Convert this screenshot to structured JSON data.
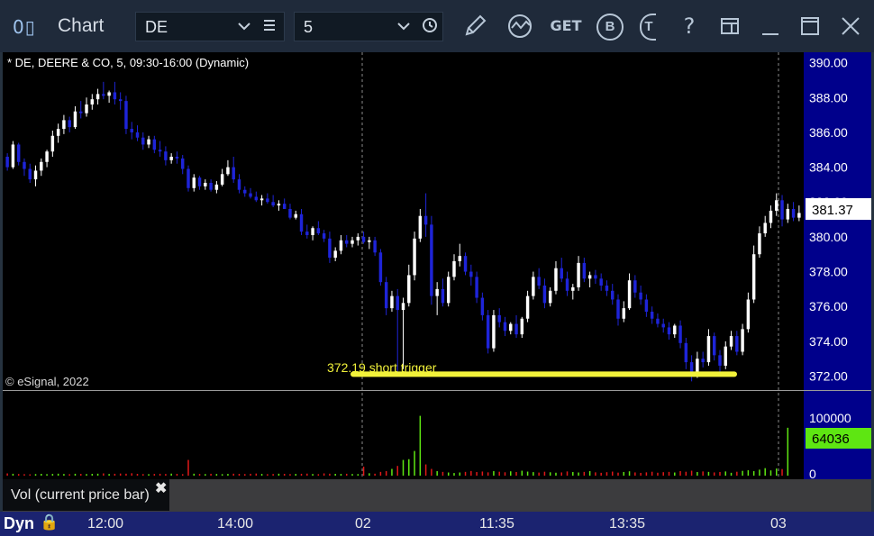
{
  "window": {
    "logo": "0▯",
    "title": "Chart",
    "symbol_value": "DE",
    "interval_value": "5",
    "icons": [
      "drawing-pencil-icon",
      "study-icon",
      "get-icon",
      "b-icon",
      "t-icon",
      "help-icon",
      "layout-icon",
      "minimize-icon",
      "maximize-icon",
      "close-icon"
    ],
    "get_label": "GET",
    "b_label": "B",
    "t_label": "T",
    "help_label": "?"
  },
  "chart": {
    "header": "* DE, DEERE & CO, 5, 09:30-16:00 (Dynamic)",
    "watermark": "© eSignal, 2022",
    "last_price": "381.37",
    "annotation_text": "372.19 short trigger",
    "annotation_color": "#f2f23a",
    "up_color": "#ffffff",
    "down_color": "#1e24d8",
    "price_axis": [
      "390.00",
      "388.00",
      "386.00",
      "384.00",
      "382.00",
      "380.00",
      "378.00",
      "376.00",
      "374.00",
      "372.00"
    ],
    "volume_axis": [
      "100000",
      "0"
    ],
    "volume_last": "64036",
    "volume_label": "Vol (current price bar)",
    "close_label": "✖",
    "time_labels": [
      "12:00",
      "14:00",
      "02",
      "11:35",
      "13:35",
      "03"
    ],
    "dyn_label": "Dyn",
    "lock_label": "🔒"
  },
  "chart_data": {
    "type": "candlestick",
    "symbol": "DE",
    "ylim": [
      371.2,
      390.6
    ],
    "price_ticks": [
      390,
      388,
      386,
      384,
      382,
      380,
      378,
      376,
      374,
      372
    ],
    "support_level": 372.19,
    "last_price": 381.37,
    "volume_last": 64036,
    "volume_max": 100000,
    "candles": [
      [
        384.6,
        384.8,
        383.8,
        384.0
      ],
      [
        384.0,
        385.5,
        383.9,
        385.3
      ],
      [
        385.3,
        385.4,
        384.1,
        384.3
      ],
      [
        384.3,
        384.5,
        383.5,
        383.9
      ],
      [
        383.9,
        384.2,
        383.1,
        383.3
      ],
      [
        383.3,
        384.1,
        382.9,
        383.8
      ],
      [
        383.8,
        384.5,
        383.5,
        384.3
      ],
      [
        384.3,
        385.0,
        384.0,
        384.9
      ],
      [
        384.9,
        386.1,
        384.6,
        385.8
      ],
      [
        385.8,
        386.5,
        385.4,
        386.2
      ],
      [
        386.2,
        387.0,
        385.9,
        386.7
      ],
      [
        386.7,
        386.9,
        386.0,
        386.3
      ],
      [
        386.3,
        387.5,
        386.2,
        387.2
      ],
      [
        387.2,
        387.8,
        386.8,
        387.1
      ],
      [
        387.1,
        388.0,
        386.9,
        387.6
      ],
      [
        387.6,
        388.2,
        387.3,
        387.9
      ],
      [
        387.9,
        388.5,
        387.6,
        388.2
      ],
      [
        388.2,
        388.9,
        387.9,
        388.1
      ],
      [
        388.1,
        388.4,
        387.7,
        388.3
      ],
      [
        388.3,
        388.9,
        387.6,
        387.9
      ],
      [
        387.9,
        388.3,
        387.3,
        387.8
      ],
      [
        387.8,
        388.1,
        385.9,
        386.2
      ],
      [
        386.2,
        386.6,
        385.6,
        386.0
      ],
      [
        386.0,
        386.4,
        385.5,
        385.7
      ],
      [
        385.7,
        386.0,
        385.0,
        385.3
      ],
      [
        385.3,
        385.8,
        385.1,
        385.6
      ],
      [
        385.6,
        385.8,
        384.8,
        385.0
      ],
      [
        385.0,
        385.5,
        384.6,
        384.9
      ],
      [
        384.9,
        385.2,
        384.1,
        384.4
      ],
      [
        384.4,
        384.8,
        384.2,
        384.6
      ],
      [
        384.6,
        384.9,
        384.2,
        384.5
      ],
      [
        384.5,
        384.7,
        383.6,
        383.9
      ],
      [
        383.9,
        384.1,
        382.6,
        382.8
      ],
      [
        382.8,
        383.6,
        382.6,
        383.4
      ],
      [
        383.4,
        383.5,
        382.7,
        382.9
      ],
      [
        382.9,
        383.3,
        382.7,
        383.1
      ],
      [
        383.1,
        383.3,
        382.6,
        382.7
      ],
      [
        382.7,
        383.2,
        382.5,
        383.0
      ],
      [
        383.0,
        383.9,
        382.9,
        383.6
      ],
      [
        383.6,
        384.4,
        383.5,
        384.0
      ],
      [
        384.0,
        384.6,
        383.1,
        383.3
      ],
      [
        383.3,
        383.6,
        382.5,
        382.7
      ],
      [
        382.7,
        382.9,
        382.3,
        382.5
      ],
      [
        382.5,
        382.8,
        382.2,
        382.3
      ],
      [
        382.3,
        382.6,
        382.0,
        382.1
      ],
      [
        382.1,
        382.4,
        381.8,
        382.2
      ],
      [
        382.2,
        382.5,
        381.9,
        382.0
      ],
      [
        382.0,
        382.4,
        381.7,
        381.8
      ],
      [
        381.8,
        382.1,
        381.5,
        381.9
      ],
      [
        381.9,
        382.2,
        381.6,
        381.6
      ],
      [
        381.6,
        381.9,
        381.0,
        381.1
      ],
      [
        381.1,
        381.5,
        381.0,
        381.3
      ],
      [
        381.3,
        381.6,
        380.1,
        380.3
      ],
      [
        380.3,
        380.7,
        379.9,
        380.1
      ],
      [
        380.1,
        380.6,
        379.8,
        380.5
      ],
      [
        380.5,
        380.9,
        380.1,
        380.2
      ],
      [
        380.2,
        380.4,
        379.7,
        379.9
      ],
      [
        379.9,
        380.3,
        378.5,
        378.8
      ],
      [
        378.8,
        379.4,
        378.6,
        379.2
      ],
      [
        379.2,
        380.1,
        379.0,
        379.8
      ],
      [
        379.8,
        380.1,
        379.4,
        379.6
      ],
      [
        379.6,
        380.0,
        379.4,
        379.8
      ],
      [
        379.8,
        380.2,
        379.5,
        380.0
      ],
      [
        380.0,
        380.3,
        379.6,
        379.7
      ],
      [
        379.7,
        380.0,
        379.3,
        379.8
      ],
      [
        379.8,
        380.0,
        378.9,
        379.1
      ],
      [
        379.1,
        379.3,
        377.2,
        377.4
      ],
      [
        377.4,
        377.7,
        375.5,
        375.9
      ],
      [
        375.9,
        376.9,
        375.7,
        376.6
      ],
      [
        376.6,
        377.0,
        372.2,
        375.8
      ],
      [
        375.8,
        376.5,
        372.4,
        376.2
      ],
      [
        376.2,
        378.4,
        376.0,
        377.8
      ],
      [
        377.8,
        380.3,
        377.5,
        379.9
      ],
      [
        379.9,
        381.6,
        379.7,
        381.2
      ],
      [
        381.2,
        382.5,
        380.0,
        380.7
      ],
      [
        380.7,
        381.2,
        376.1,
        376.6
      ],
      [
        376.6,
        377.4,
        375.5,
        377.0
      ],
      [
        377.0,
        377.6,
        376.0,
        376.2
      ],
      [
        376.2,
        378.0,
        376.0,
        377.7
      ],
      [
        377.7,
        379.0,
        377.5,
        378.6
      ],
      [
        378.6,
        379.6,
        378.3,
        378.9
      ],
      [
        378.9,
        379.1,
        377.8,
        378.0
      ],
      [
        378.0,
        378.4,
        377.2,
        377.7
      ],
      [
        377.7,
        378.0,
        376.2,
        376.5
      ],
      [
        376.5,
        376.8,
        375.2,
        375.5
      ],
      [
        375.5,
        375.8,
        373.3,
        373.6
      ],
      [
        373.6,
        375.8,
        373.4,
        375.5
      ],
      [
        375.5,
        375.9,
        374.8,
        375.1
      ],
      [
        375.1,
        375.4,
        374.3,
        374.6
      ],
      [
        374.6,
        375.1,
        374.4,
        375.0
      ],
      [
        375.0,
        375.5,
        374.2,
        374.4
      ],
      [
        374.4,
        375.4,
        374.2,
        375.3
      ],
      [
        375.3,
        376.9,
        375.1,
        376.6
      ],
      [
        376.6,
        378.0,
        376.4,
        377.7
      ],
      [
        377.7,
        378.2,
        377.0,
        377.2
      ],
      [
        377.2,
        377.6,
        375.9,
        376.2
      ],
      [
        376.2,
        377.1,
        376.0,
        376.9
      ],
      [
        376.9,
        378.6,
        376.7,
        378.2
      ],
      [
        378.2,
        378.8,
        377.4,
        377.6
      ],
      [
        377.6,
        378.0,
        376.6,
        376.9
      ],
      [
        376.9,
        377.3,
        376.4,
        377.1
      ],
      [
        377.1,
        378.9,
        376.9,
        378.5
      ],
      [
        378.5,
        378.8,
        377.4,
        377.6
      ],
      [
        377.6,
        378.0,
        377.1,
        377.8
      ],
      [
        377.8,
        378.1,
        377.3,
        377.6
      ],
      [
        377.6,
        377.9,
        376.9,
        377.2
      ],
      [
        377.2,
        377.5,
        376.6,
        376.9
      ],
      [
        376.9,
        377.3,
        376.1,
        376.4
      ],
      [
        376.4,
        376.7,
        374.9,
        375.3
      ],
      [
        375.3,
        376.3,
        375.1,
        375.9
      ],
      [
        375.9,
        377.9,
        375.8,
        377.5
      ],
      [
        377.5,
        377.8,
        376.5,
        376.8
      ],
      [
        376.8,
        377.2,
        376.1,
        376.4
      ],
      [
        376.4,
        376.7,
        375.4,
        375.7
      ],
      [
        375.7,
        376.0,
        375.0,
        375.3
      ],
      [
        375.3,
        375.6,
        374.8,
        375.0
      ],
      [
        375.0,
        375.3,
        374.5,
        374.8
      ],
      [
        374.8,
        375.1,
        374.1,
        374.4
      ],
      [
        374.4,
        375.0,
        374.2,
        374.9
      ],
      [
        374.9,
        375.2,
        373.6,
        373.9
      ],
      [
        373.9,
        374.2,
        372.4,
        372.8
      ],
      [
        372.8,
        373.2,
        371.7,
        372.1
      ],
      [
        372.1,
        373.4,
        371.9,
        373.0
      ],
      [
        373.0,
        373.4,
        372.5,
        372.8
      ],
      [
        372.8,
        374.7,
        372.6,
        374.3
      ],
      [
        374.3,
        374.5,
        372.9,
        373.2
      ],
      [
        373.2,
        373.5,
        372.2,
        372.6
      ],
      [
        372.6,
        374.0,
        372.4,
        373.7
      ],
      [
        373.7,
        374.6,
        373.5,
        374.3
      ],
      [
        374.3,
        374.6,
        373.2,
        373.4
      ],
      [
        373.4,
        375.0,
        373.2,
        374.7
      ],
      [
        374.7,
        376.8,
        374.5,
        376.4
      ],
      [
        376.4,
        379.5,
        376.2,
        379.0
      ],
      [
        379.0,
        380.6,
        378.8,
        380.2
      ],
      [
        380.2,
        381.2,
        380.0,
        380.8
      ],
      [
        380.8,
        381.8,
        380.5,
        381.5
      ],
      [
        381.5,
        382.5,
        381.2,
        382.1
      ],
      [
        382.1,
        382.4,
        380.6,
        381.0
      ],
      [
        381.0,
        381.9,
        380.8,
        381.6
      ],
      [
        381.6,
        382.0,
        380.9,
        381.1
      ],
      [
        381.1,
        381.8,
        380.9,
        381.37
      ]
    ],
    "volumes": [
      3000,
      2500,
      2200,
      2000,
      1800,
      2100,
      2400,
      2000,
      2300,
      2600,
      2200,
      2000,
      2500,
      2300,
      2100,
      2400,
      2600,
      3000,
      2200,
      2500,
      2800,
      2600,
      3200,
      2400,
      2100,
      2000,
      2300,
      2500,
      2200,
      2700,
      2400,
      2000,
      21000,
      2600,
      2300,
      2100,
      2500,
      2200,
      2000,
      2300,
      2600,
      2400,
      2100,
      2500,
      2800,
      2300,
      2000,
      2200,
      2600,
      2400,
      2100,
      2300,
      2500,
      2700,
      2200,
      2000,
      3000,
      2600,
      2400,
      2300,
      2500,
      2200,
      2100,
      12000,
      3200,
      2600,
      5000,
      6000,
      9000,
      13000,
      21000,
      22000,
      33000,
      80000,
      15000,
      9000,
      6000,
      5000,
      4200,
      3500,
      4200,
      5000,
      6200,
      4800,
      5500,
      4400,
      6000,
      5200,
      4500,
      5800,
      4900,
      6600,
      5400,
      4700,
      4100,
      5200,
      4500,
      3900,
      4300,
      5600,
      4800,
      4200,
      5000,
      6100,
      4400,
      3800,
      4600,
      5400,
      4000,
      4900,
      5800,
      4300,
      3700,
      4400,
      5200,
      3900,
      4600,
      5000,
      4200,
      6000,
      5200,
      6600,
      4800,
      5600,
      5000,
      4300,
      4900,
      5600,
      3800,
      5200,
      6400,
      7200,
      6000,
      8000,
      10000,
      7000,
      9500,
      8800,
      64036
    ]
  }
}
